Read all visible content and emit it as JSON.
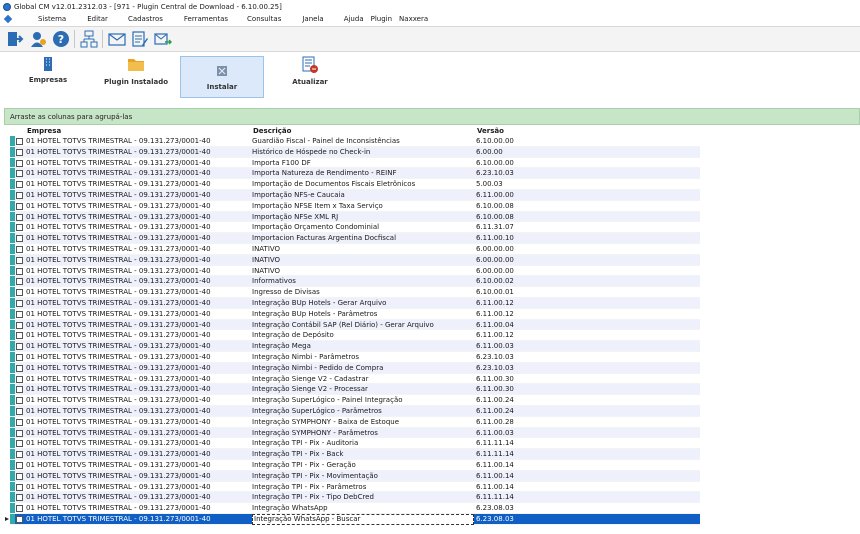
{
  "window": {
    "title": "Global CM v12.01.2312.03 - [971 - Plugin Central de Download - 6.10.00.25]"
  },
  "menu": [
    "Sistema",
    "Editar",
    "Cadastros",
    "Ferramentas",
    "Consultas",
    "Janela",
    "Ajuda",
    "Plugin",
    "Naxxera"
  ],
  "toolbar": {
    "icons": [
      "exit-icon",
      "user-icon",
      "help-icon",
      "network-icon",
      "mail-icon",
      "edit-list-icon",
      "mail-send-icon"
    ]
  },
  "ribbon": {
    "buttons": [
      {
        "label": "Empresas",
        "icon": "building-icon"
      },
      {
        "label": "Plugin Instalado",
        "icon": "folder-icon"
      },
      {
        "label": "Instalar",
        "icon": "install-icon"
      },
      {
        "label": "Atualizar",
        "icon": "update-icon"
      }
    ],
    "active_index": 2
  },
  "grid": {
    "group_hint": "Arraste as colunas para agrupá-las",
    "columns": [
      "Empresa",
      "Descrição",
      "Versão"
    ],
    "selected_row": 35,
    "rows": [
      [
        "01 HOTEL TOTVS TRIMESTRAL -  09.131.273/0001-40",
        "Guardião Fiscal - Painel de Inconsistências",
        "6.10.00.00"
      ],
      [
        "01 HOTEL TOTVS TRIMESTRAL -  09.131.273/0001-40",
        "Histórico de Hóspede no Check-in",
        "6.00.00"
      ],
      [
        "01 HOTEL TOTVS TRIMESTRAL -  09.131.273/0001-40",
        "Importa F100 DF",
        "6.10.00.00"
      ],
      [
        "01 HOTEL TOTVS TRIMESTRAL -  09.131.273/0001-40",
        "Importa Natureza de Rendimento - REINF",
        "6.23.10.03"
      ],
      [
        "01 HOTEL TOTVS TRIMESTRAL -  09.131.273/0001-40",
        "Importação de Documentos Fiscais Eletrônicos",
        "5.00.03"
      ],
      [
        "01 HOTEL TOTVS TRIMESTRAL -  09.131.273/0001-40",
        "Importação NFS-e Caucaia",
        "6.11.00.00"
      ],
      [
        "01 HOTEL TOTVS TRIMESTRAL -  09.131.273/0001-40",
        "Importação NFSE Item x Taxa Serviço",
        "6.10.00.08"
      ],
      [
        "01 HOTEL TOTVS TRIMESTRAL -  09.131.273/0001-40",
        "Importação NFSe XML RJ",
        "6.10.00.08"
      ],
      [
        "01 HOTEL TOTVS TRIMESTRAL -  09.131.273/0001-40",
        "Importação Orçamento Condominial",
        "6.11.31.07"
      ],
      [
        "01 HOTEL TOTVS TRIMESTRAL -  09.131.273/0001-40",
        "Importacion Facturas Argentina Docfiscal",
        "6.11.00.10"
      ],
      [
        "01 HOTEL TOTVS TRIMESTRAL -  09.131.273/0001-40",
        "INATIVO",
        "6.00.00.00"
      ],
      [
        "01 HOTEL TOTVS TRIMESTRAL -  09.131.273/0001-40",
        "INATIVO",
        "6.00.00.00"
      ],
      [
        "01 HOTEL TOTVS TRIMESTRAL -  09.131.273/0001-40",
        "INATIVO",
        "6.00.00.00"
      ],
      [
        "01 HOTEL TOTVS TRIMESTRAL -  09.131.273/0001-40",
        "Informativos",
        "6.10.00.02"
      ],
      [
        "01 HOTEL TOTVS TRIMESTRAL -  09.131.273/0001-40",
        "Ingresso de Divisas",
        "6.10.00.01"
      ],
      [
        "01 HOTEL TOTVS TRIMESTRAL -  09.131.273/0001-40",
        "Integração BUp Hotels - Gerar Arquivo",
        "6.11.00.12"
      ],
      [
        "01 HOTEL TOTVS TRIMESTRAL -  09.131.273/0001-40",
        "Integração BUp Hotels - Parâmetros",
        "6.11.00.12"
      ],
      [
        "01 HOTEL TOTVS TRIMESTRAL -  09.131.273/0001-40",
        "Integração Contábil SAP (Rel Diário) - Gerar Arquivo",
        "6.11.00.04"
      ],
      [
        "01 HOTEL TOTVS TRIMESTRAL -  09.131.273/0001-40",
        "Integração de Depósito",
        "6.11.00.12"
      ],
      [
        "01 HOTEL TOTVS TRIMESTRAL -  09.131.273/0001-40",
        "Integração Mega",
        "6.11.00.03"
      ],
      [
        "01 HOTEL TOTVS TRIMESTRAL -  09.131.273/0001-40",
        "Integração Nimbi - Parâmetros",
        "6.23.10.03"
      ],
      [
        "01 HOTEL TOTVS TRIMESTRAL -  09.131.273/0001-40",
        "Integração Nimbi - Pedido de Compra",
        "6.23.10.03"
      ],
      [
        "01 HOTEL TOTVS TRIMESTRAL -  09.131.273/0001-40",
        "Integração Sienge V2 - Cadastrar",
        "6.11.00.30"
      ],
      [
        "01 HOTEL TOTVS TRIMESTRAL -  09.131.273/0001-40",
        "Integração Sienge V2 - Processar",
        "6.11.00.30"
      ],
      [
        "01 HOTEL TOTVS TRIMESTRAL -  09.131.273/0001-40",
        "Integração SuperLógico - Painel Integração",
        "6.11.00.24"
      ],
      [
        "01 HOTEL TOTVS TRIMESTRAL -  09.131.273/0001-40",
        "Integração SuperLógico - Parâmetros",
        "6.11.00.24"
      ],
      [
        "01 HOTEL TOTVS TRIMESTRAL -  09.131.273/0001-40",
        "Integração SYMPHONY - Baixa de Estoque",
        "6.11.00.28"
      ],
      [
        "01 HOTEL TOTVS TRIMESTRAL -  09.131.273/0001-40",
        "Integração SYMPHONY - Parâmetros",
        "6.11.00.03"
      ],
      [
        "01 HOTEL TOTVS TRIMESTRAL -  09.131.273/0001-40",
        "Integração TPI - Pix - Auditoria",
        "6.11.11.14"
      ],
      [
        "01 HOTEL TOTVS TRIMESTRAL -  09.131.273/0001-40",
        "Integração TPI - Pix - Back",
        "6.11.11.14"
      ],
      [
        "01 HOTEL TOTVS TRIMESTRAL -  09.131.273/0001-40",
        "Integração TPI - Pix - Geração",
        "6.11.00.14"
      ],
      [
        "01 HOTEL TOTVS TRIMESTRAL -  09.131.273/0001-40",
        "Integração TPI - Pix - Movimentação",
        "6.11.00.14"
      ],
      [
        "01 HOTEL TOTVS TRIMESTRAL -  09.131.273/0001-40",
        "Integração TPI - Pix - Parâmetros",
        "6.11.00.14"
      ],
      [
        "01 HOTEL TOTVS TRIMESTRAL -  09.131.273/0001-40",
        "Integração TPI - Pix - Tipo DebCred",
        "6.11.11.14"
      ],
      [
        "01 HOTEL TOTVS TRIMESTRAL -  09.131.273/0001-40",
        "Integração WhatsApp",
        "6.23.08.03"
      ],
      [
        "01 HOTEL TOTVS TRIMESTRAL -  09.131.273/0001-40",
        "Integração WhatsApp - Buscar",
        "6.23.08.03"
      ]
    ]
  },
  "colors": {
    "selection": "#0f5fc4",
    "group_bar": "#c7e6c7",
    "row_stripe": "#eef0fb",
    "indicator": "#33a9a9"
  }
}
